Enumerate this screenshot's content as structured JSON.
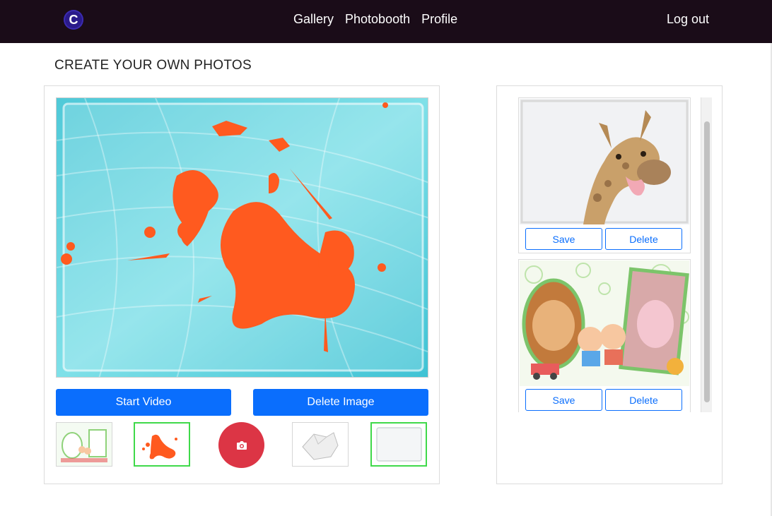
{
  "nav": {
    "logo_letter": "C",
    "links": [
      "Gallery",
      "Photobooth",
      "Profile"
    ],
    "logout": "Log out"
  },
  "page": {
    "title": "CREATE YOUR OWN PHOTOS"
  },
  "controls": {
    "start_video": "Start Video",
    "delete_image": "Delete Image",
    "capture_icon": "camera-icon"
  },
  "stickers": [
    {
      "icon": "baby-frame-sticker",
      "selected": false
    },
    {
      "icon": "orange-splash-sticker",
      "selected": true
    },
    {
      "icon": "camera-capture",
      "selected": false
    },
    {
      "icon": "torn-paper-sticker",
      "selected": false
    },
    {
      "icon": "white-frame-sticker",
      "selected": true
    }
  ],
  "gallery": {
    "items": [
      {
        "image": "giraffe-photo",
        "save": "Save",
        "delete": "Delete"
      },
      {
        "image": "baby-frame-photo",
        "save": "Save",
        "delete": "Delete"
      }
    ]
  },
  "colors": {
    "navbar": "#1a0c18",
    "primary": "#0a6efd",
    "capture": "#dc3545",
    "selected_border": "#3fd94a",
    "splash": "#ff5a1f",
    "canvas_bg": "#5fd3e0"
  }
}
